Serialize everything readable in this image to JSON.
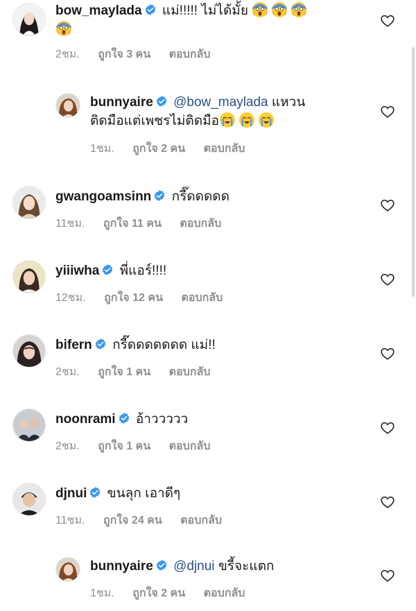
{
  "comments": [
    {
      "username": "bow_maylada",
      "text": "แม่!!!!! ไม่ได้มั้ย",
      "time": "2ชม.",
      "likes": "ถูกใจ 3 คน",
      "reply": "ตอบกลับ"
    },
    {
      "username": "bunnyaire",
      "mention": "@bow_maylada",
      "text_line1": "แหวน",
      "text_line2": "ติดมือแต่เพชรไม่ติดมือ",
      "time": "1ชม.",
      "likes": "ถูกใจ 2 คน",
      "reply": "ตอบกลับ"
    },
    {
      "username": "gwangoamsinn",
      "text": "กรี๊ดดดดด",
      "time": "11ชม.",
      "likes": "ถูกใจ 11 คน",
      "reply": "ตอบกลับ"
    },
    {
      "username": "yiiiwha",
      "text": "พี่แอร์!!!!",
      "time": "12ชม.",
      "likes": "ถูกใจ 12 คน",
      "reply": "ตอบกลับ"
    },
    {
      "username": "bifern",
      "text": "กรี๊ดดดดดดด แม่!!",
      "time": "2ชม.",
      "likes": "ถูกใจ 1 คน",
      "reply": "ตอบกลับ"
    },
    {
      "username": "noonrami",
      "text": "อ้าววววว",
      "time": "2ชม.",
      "likes": "ถูกใจ 1 คน",
      "reply": "ตอบกลับ"
    },
    {
      "username": "djnui",
      "text": "ขนลุก เอาดีๆ",
      "time": "11ชม.",
      "likes": "ถูกใจ 24 คน",
      "reply": "ตอบกลับ"
    },
    {
      "username": "bunnyaire",
      "mention": "@djnui",
      "text": "ขรี้จะแตก",
      "time": "1ชม.",
      "likes": "ถูกใจ 2 คน",
      "reply": "ตอบกลับ"
    }
  ],
  "icons": {
    "verified": "verified-badge-icon",
    "like": "heart-icon",
    "emoji_scream": "face-screaming-emoji",
    "emoji_cry": "loudly-crying-face-emoji"
  },
  "colors": {
    "verified": "#3897f0",
    "mention": "#2b4f8a",
    "meta": "#8e8e8e"
  }
}
